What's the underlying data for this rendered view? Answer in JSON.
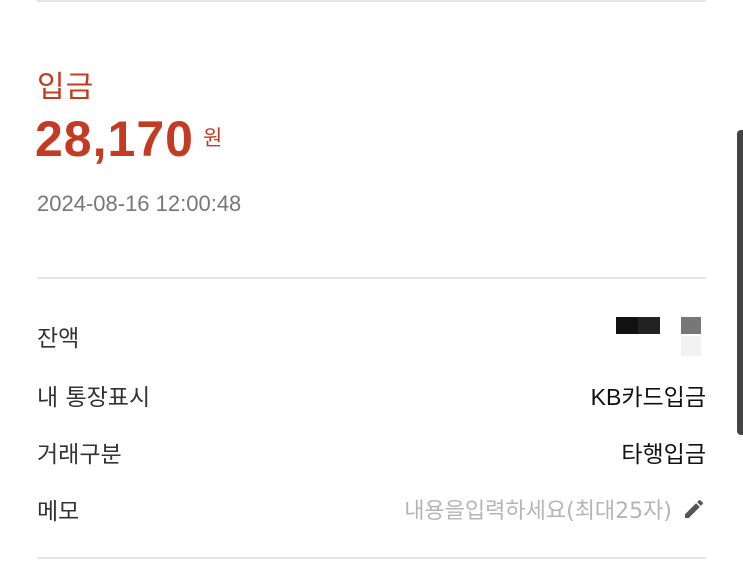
{
  "header": {
    "type_label": "입금",
    "amount": "28,170",
    "currency": "원",
    "timestamp": "2024-08-16 12:00:48"
  },
  "details": {
    "balance": {
      "label": "잔액"
    },
    "my_display": {
      "label": "내 통장표시",
      "value": "KB카드입금"
    },
    "category": {
      "label": "거래구분",
      "value": "타행입금"
    },
    "memo": {
      "label": "메모",
      "placeholder": "내용을입력하세요(최대25자)"
    }
  },
  "icons": {
    "edit": "pencil-icon"
  },
  "colors": {
    "accent": "#c23b22",
    "label": "#333333",
    "placeholder": "#b5b5b5"
  }
}
